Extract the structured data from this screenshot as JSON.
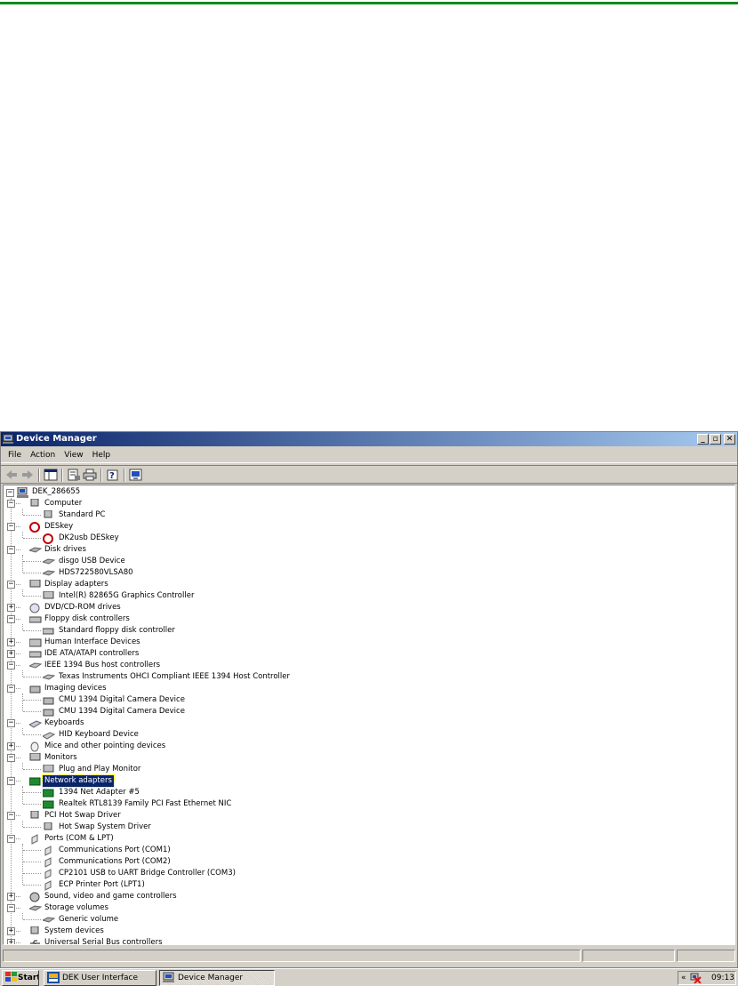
{
  "window": {
    "title": "Device Manager"
  },
  "window_controls": {
    "minimize": "_",
    "maximize": "▫",
    "close": "✕"
  },
  "menu": [
    "File",
    "Action",
    "View",
    "Help"
  ],
  "tree": {
    "expanded_symbol": "−",
    "collapsed_symbol": "+",
    "root": "DEK_286655",
    "nodes": [
      {
        "label": "Computer",
        "level": 1,
        "state": "expanded",
        "icon": "computer-icon"
      },
      {
        "label": "Standard PC",
        "level": 2,
        "icon": "computer-icon"
      },
      {
        "label": "DESkey",
        "level": 1,
        "state": "expanded",
        "icon": "deskey-icon"
      },
      {
        "label": "DK2usb DESkey",
        "level": 2,
        "icon": "deskey-icon"
      },
      {
        "label": "Disk drives",
        "level": 1,
        "state": "expanded",
        "icon": "disk-drive-icon"
      },
      {
        "label": "disgo USB Device",
        "level": 2,
        "icon": "disk-drive-icon"
      },
      {
        "label": "HDS722580VLSA80",
        "level": 2,
        "icon": "disk-drive-icon"
      },
      {
        "label": "Display adapters",
        "level": 1,
        "state": "expanded",
        "icon": "monitor-icon"
      },
      {
        "label": "Intel(R) 82865G Graphics Controller",
        "level": 2,
        "icon": "monitor-icon"
      },
      {
        "label": "DVD/CD-ROM drives",
        "level": 1,
        "state": "collapsed",
        "icon": "cdrom-icon"
      },
      {
        "label": "Floppy disk controllers",
        "level": 1,
        "state": "expanded",
        "icon": "floppy-controller-icon"
      },
      {
        "label": "Standard floppy disk controller",
        "level": 2,
        "icon": "warning-device-icon"
      },
      {
        "label": "Human Interface Devices",
        "level": 1,
        "state": "collapsed",
        "icon": "hid-icon"
      },
      {
        "label": "IDE ATA/ATAPI controllers",
        "level": 1,
        "state": "collapsed",
        "icon": "ide-controller-icon"
      },
      {
        "label": "IEEE 1394 Bus host controllers",
        "level": 1,
        "state": "expanded",
        "icon": "ieee1394-icon"
      },
      {
        "label": "Texas Instruments OHCI Compliant IEEE 1394 Host Controller",
        "level": 2,
        "icon": "ieee1394-icon"
      },
      {
        "label": "Imaging devices",
        "level": 1,
        "state": "expanded",
        "icon": "camera-icon"
      },
      {
        "label": "CMU 1394 Digital Camera Device",
        "level": 2,
        "icon": "camera-icon"
      },
      {
        "label": "CMU 1394 Digital Camera Device",
        "level": 2,
        "icon": "camera-icon"
      },
      {
        "label": "Keyboards",
        "level": 1,
        "state": "expanded",
        "icon": "keyboard-icon"
      },
      {
        "label": "HID Keyboard Device",
        "level": 2,
        "icon": "keyboard-icon"
      },
      {
        "label": "Mice and other pointing devices",
        "level": 1,
        "state": "collapsed",
        "icon": "mouse-icon"
      },
      {
        "label": "Monitors",
        "level": 1,
        "state": "expanded",
        "icon": "monitor-icon"
      },
      {
        "label": "Plug and Play Monitor",
        "level": 2,
        "icon": "monitor-icon"
      },
      {
        "label": "Network adapters",
        "level": 1,
        "state": "expanded",
        "icon": "network-card-icon",
        "selected": true
      },
      {
        "label": "1394 Net Adapter #5",
        "level": 2,
        "icon": "network-card-icon"
      },
      {
        "label": "Realtek RTL8139 Family PCI Fast Ethernet NIC",
        "level": 2,
        "icon": "network-card-icon"
      },
      {
        "label": "PCI Hot Swap Driver",
        "level": 1,
        "state": "expanded",
        "icon": "computer-icon"
      },
      {
        "label": "Hot Swap System Driver",
        "level": 2,
        "icon": "computer-icon"
      },
      {
        "label": "Ports (COM & LPT)",
        "level": 1,
        "state": "expanded",
        "icon": "port-icon"
      },
      {
        "label": "Communications Port (COM1)",
        "level": 2,
        "icon": "port-icon"
      },
      {
        "label": "Communications Port (COM2)",
        "level": 2,
        "icon": "port-icon"
      },
      {
        "label": "CP2101 USB to UART Bridge Controller (COM3)",
        "level": 2,
        "icon": "port-icon"
      },
      {
        "label": "ECP Printer Port (LPT1)",
        "level": 2,
        "icon": "port-icon"
      },
      {
        "label": "Sound, video and game controllers",
        "level": 1,
        "state": "collapsed",
        "icon": "sound-icon"
      },
      {
        "label": "Storage volumes",
        "level": 1,
        "state": "expanded",
        "icon": "disk-drive-icon"
      },
      {
        "label": "Generic volume",
        "level": 2,
        "icon": "disk-drive-icon"
      },
      {
        "label": "System devices",
        "level": 1,
        "state": "collapsed",
        "icon": "computer-icon"
      },
      {
        "label": "Universal Serial Bus controllers",
        "level": 1,
        "state": "collapsed",
        "icon": "usb-icon"
      }
    ]
  },
  "taskbar": {
    "start": "Start",
    "buttons": [
      {
        "label": "DEK User Interface",
        "active": false
      },
      {
        "label": "Device Manager",
        "active": true
      }
    ],
    "tray_chevron": "«",
    "clock": "09:13"
  },
  "colors": {
    "accent_rule": "#0a8a1e",
    "titlebar": "#0a246a",
    "selection": "#0a246a",
    "chrome": "#d4d0c8"
  }
}
